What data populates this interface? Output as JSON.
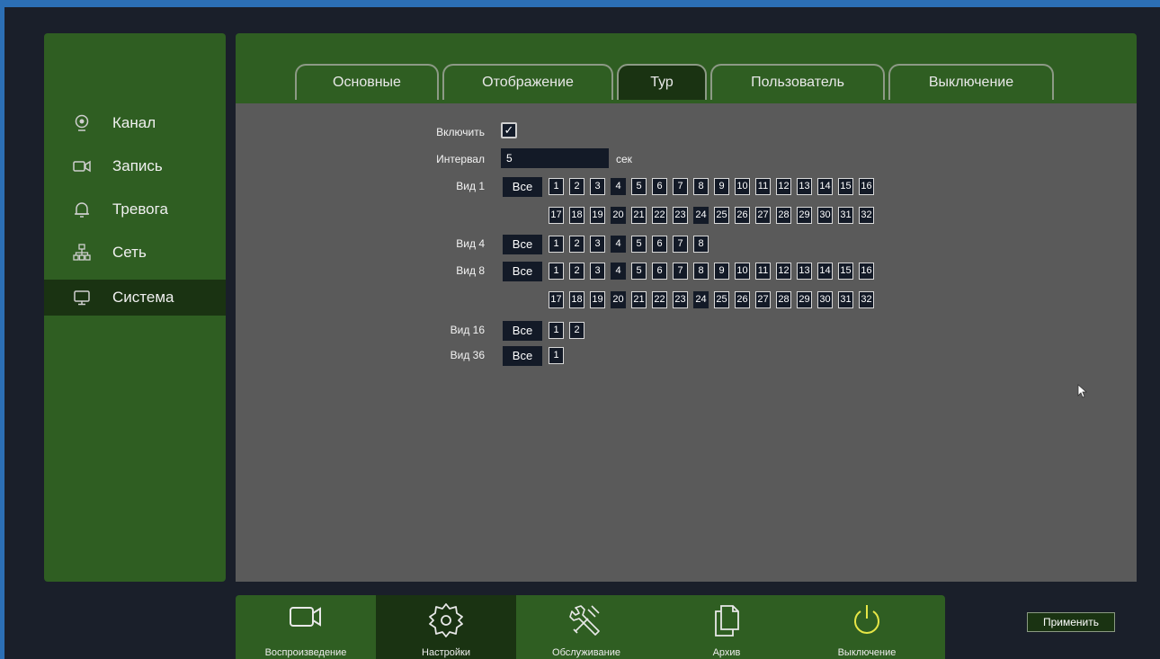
{
  "sidebar": {
    "items": [
      {
        "label": "Канал",
        "icon": "camera-icon"
      },
      {
        "label": "Запись",
        "icon": "record-icon"
      },
      {
        "label": "Тревога",
        "icon": "bell-icon"
      },
      {
        "label": "Сеть",
        "icon": "network-icon"
      },
      {
        "label": "Система",
        "icon": "monitor-icon",
        "active": true
      }
    ]
  },
  "tabs": [
    "Основные",
    "Отображение",
    "Тур",
    "Пользователь",
    "Выключение"
  ],
  "active_tab": "Тур",
  "form": {
    "enable_label": "Включить",
    "enable_checked": "✓",
    "interval_label": "Интервал",
    "interval_value": "5",
    "interval_unit": "сек",
    "all_label": "Все",
    "view1_label": "Вид 1",
    "view4_label": "Вид 4",
    "view8_label": "Вид 8",
    "view16_label": "Вид 16",
    "view36_label": "Вид 36",
    "n": [
      "1",
      "2",
      "3",
      "4",
      "5",
      "6",
      "7",
      "8",
      "9",
      "10",
      "11",
      "12",
      "13",
      "14",
      "15",
      "16",
      "17",
      "18",
      "19",
      "20",
      "21",
      "22",
      "23",
      "24",
      "25",
      "26",
      "27",
      "28",
      "29",
      "30",
      "31",
      "32"
    ]
  },
  "apply_label": "Применить",
  "dock": {
    "items": [
      {
        "label": "Воспроизведение",
        "icon": "video-camera-icon"
      },
      {
        "label": "Настройки",
        "icon": "gear-icon",
        "active": true
      },
      {
        "label": "Обслуживание",
        "icon": "tools-icon"
      },
      {
        "label": "Архив",
        "icon": "files-icon"
      },
      {
        "label": "Выключение",
        "icon": "power-icon"
      }
    ]
  },
  "colors": {
    "panel_green": "#2f5e22",
    "active_green": "#1a3312",
    "content_gray": "#5a5a5a",
    "button_dark": "#131a27",
    "accent_blue": "#2c6fb5"
  }
}
